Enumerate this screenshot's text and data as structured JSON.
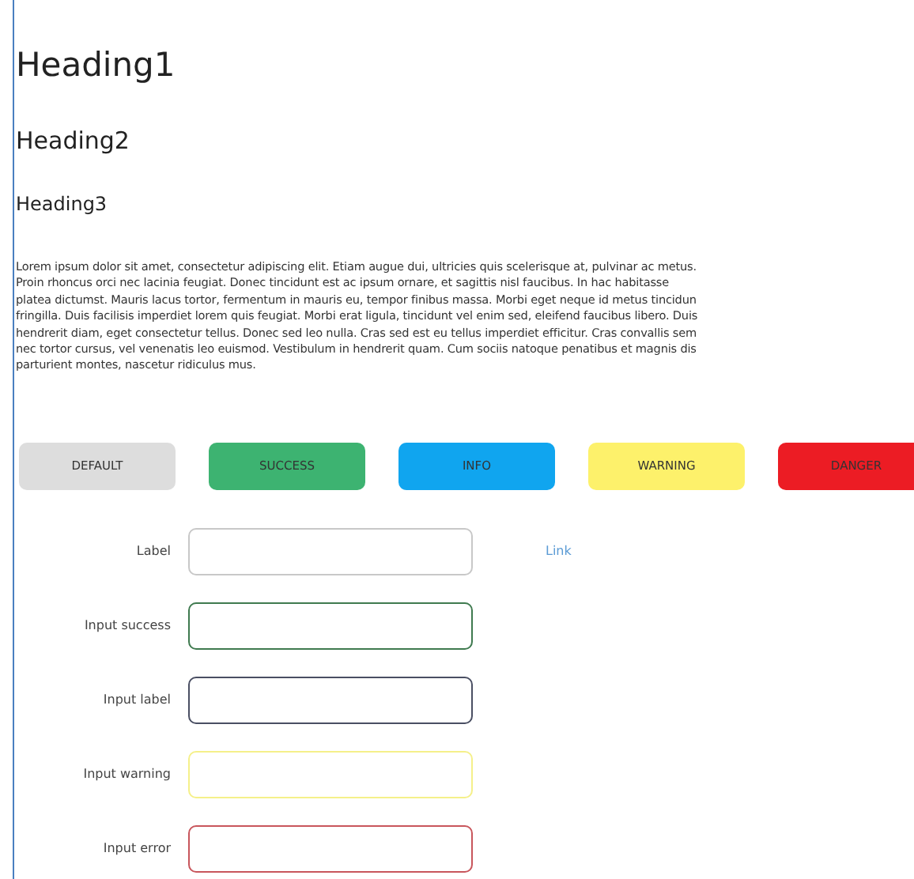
{
  "headings": [
    {
      "kind": "h1",
      "text": "Heading1"
    },
    {
      "kind": "h2",
      "text": "Heading2"
    },
    {
      "kind": "h3",
      "text": "Heading3"
    }
  ],
  "paragraph": [
    "Lorem ipsum dolor sit amet, consectetur adipiscing elit. Etiam augue dui, ultricies quis scelerisque at, pulvinar ac metus.",
    "Proin rhoncus orci nec lacinia feugiat. Donec tincidunt est ac ipsum ornare, et sagittis nisl faucibus. In hac habitasse",
    "platea dictumst. Mauris lacus tortor, fermentum in mauris eu, tempor finibus massa. Morbi eget neque id metus tincidun",
    "fringilla. Duis facilisis imperdiet lorem quis feugiat. Morbi erat ligula, tincidunt vel enim sed, eleifend faucibus libero. Duis",
    "hendrerit diam, eget consectetur tellus. Donec sed leo nulla. Cras sed est eu tellus imperdiet efficitur. Cras convallis sem",
    "nec tortor cursus, vel venenatis leo euismod. Vestibulum in hendrerit quam. Cum sociis natoque penatibus et magnis dis",
    "parturient montes, nascetur ridiculus mus."
  ],
  "buttons": [
    {
      "label": "DEFAULT",
      "color": "#dddddd"
    },
    {
      "label": "SUCCESS",
      "color": "#3db371"
    },
    {
      "label": "INFO",
      "color": "#10a5ef"
    },
    {
      "label": "WARNING",
      "color": "#fdf16b"
    },
    {
      "label": "DANGER",
      "color": "#ec1c24"
    }
  ],
  "form": [
    {
      "label": "Label",
      "color": "#c8c8c8",
      "link": "Link"
    },
    {
      "label": "Input success",
      "color": "#3f7a4f"
    },
    {
      "label": "Input label",
      "color": "#4a4f63"
    },
    {
      "label": "Input warning",
      "color": "#f5f08a"
    },
    {
      "label": "Input error",
      "color": "#c8565c"
    }
  ]
}
